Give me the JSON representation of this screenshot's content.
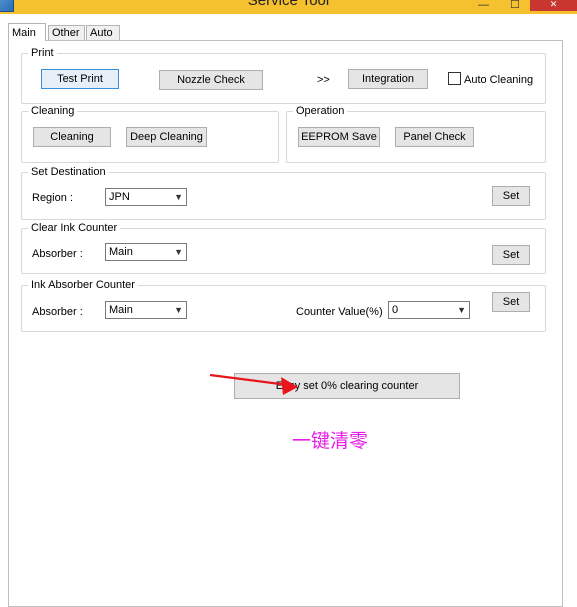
{
  "window": {
    "title": "Service Tool",
    "minimize_glyph": "—",
    "maximize_glyph": "☐",
    "close_glyph": "✕"
  },
  "tabs": [
    {
      "label": "Main",
      "active": true
    },
    {
      "label": "Other",
      "active": false
    },
    {
      "label": "Auto",
      "active": false
    }
  ],
  "print": {
    "legend": "Print",
    "test_print": "Test Print",
    "nozzle_check": "Nozzle Check",
    "arrows": ">>",
    "integration": "Integration",
    "auto_cleaning": "Auto Cleaning",
    "auto_cleaning_checked": false
  },
  "cleaning": {
    "legend": "Cleaning",
    "cleaning": "Cleaning",
    "deep_cleaning": "Deep Cleaning"
  },
  "operation": {
    "legend": "Operation",
    "eeprom_save": "EEPROM Save",
    "panel_check": "Panel Check"
  },
  "set_destination": {
    "legend": "Set Destination",
    "region_label": "Region :",
    "region_value": "JPN",
    "set": "Set"
  },
  "clear_ink_counter": {
    "legend": "Clear Ink Counter",
    "absorber_label": "Absorber :",
    "absorber_value": "Main",
    "set": "Set"
  },
  "ink_absorber_counter": {
    "legend": "Ink Absorber Counter",
    "absorber_label": "Absorber :",
    "absorber_value": "Main",
    "counter_label": "Counter Value(%)",
    "counter_value": "0",
    "set": "Set"
  },
  "easy_reset_button": "Easy set 0% clearing counter",
  "annotation_text": "一键清零",
  "colors": {
    "titlebar": "#f5c12e",
    "close": "#c7372f",
    "annotation": "#e61ee6",
    "arrow": "#e8161b"
  }
}
